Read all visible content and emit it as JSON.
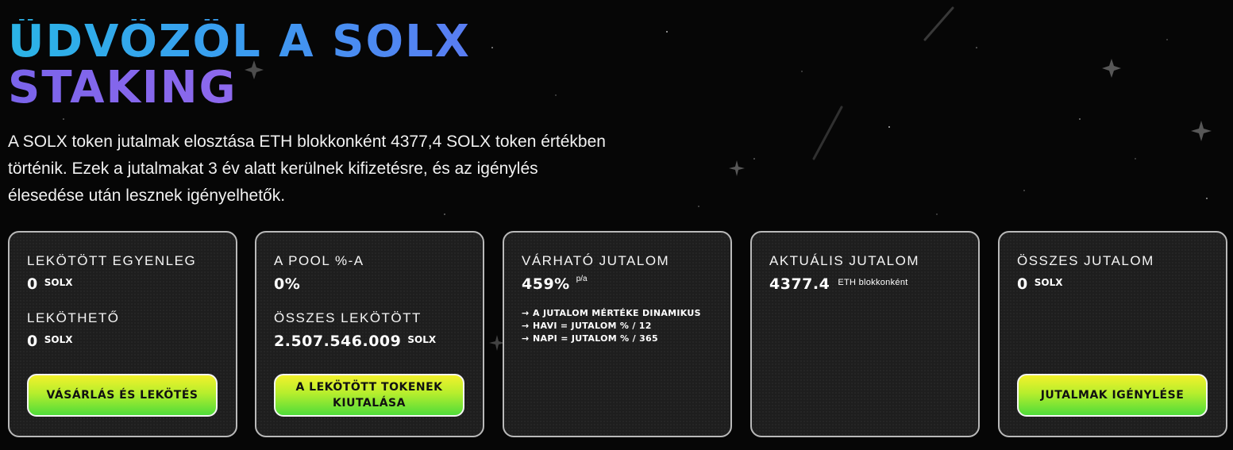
{
  "hero": {
    "title_line1": "ÜDVÖZÖL A SOLX",
    "title_line2": "STAKING",
    "description": "A SOLX token jutalmak elosztása ETH blokkonként 4377,4 SOLX token értékben történik. Ezek a jutalmakat 3 év alatt kerülnek kifizetésre, és az igénylés élesedése után lesznek igényelhetők."
  },
  "cards": {
    "staked": {
      "heading": "LEKÖTÖTT EGYENLEG",
      "value": "0",
      "unit": "SOLX",
      "sub_heading": "LEKÖTHETŐ",
      "sub_value": "0",
      "sub_unit": "SOLX",
      "button": "VÁSÁRLÁS ÉS LEKÖTÉS"
    },
    "pool": {
      "heading": "A POOL %-A",
      "value": "0%",
      "sub_heading": "ÖSSZES LEKÖTÖTT",
      "sub_value": "2.507.546.009",
      "sub_unit": "SOLX",
      "button": "A LEKÖTÖTT TOKENEK KIUTALÁSA"
    },
    "expected": {
      "heading": "VÁRHATÓ JUTALOM",
      "value": "459%",
      "unit": "p/a",
      "notes": [
        "A JUTALOM MÉRTÉKE DINAMIKUS",
        "HAVI = JUTALOM % / 12",
        "NAPI = JUTALOM % / 365"
      ],
      "note_arrow": "→"
    },
    "current": {
      "heading": "AKTUÁLIS JUTALOM",
      "value": "4377.4",
      "unit": "ETH blokkonként"
    },
    "total": {
      "heading": "ÖSSZES JUTALOM",
      "value": "0",
      "unit": "SOLX",
      "button": "JUTALMAK IGÉNYLÉSE"
    }
  },
  "colors": {
    "background": "#060606",
    "card_bg": "#1e1e1e",
    "card_border": "#b9b9b9",
    "button_top": "#f2f12b",
    "button_bottom": "#4fdc3a",
    "title_blue": "#2bb4e6",
    "title_purple": "#8a68ee"
  },
  "decor_icons": [
    "sparkle-star-icon",
    "shooting-star-icon"
  ]
}
